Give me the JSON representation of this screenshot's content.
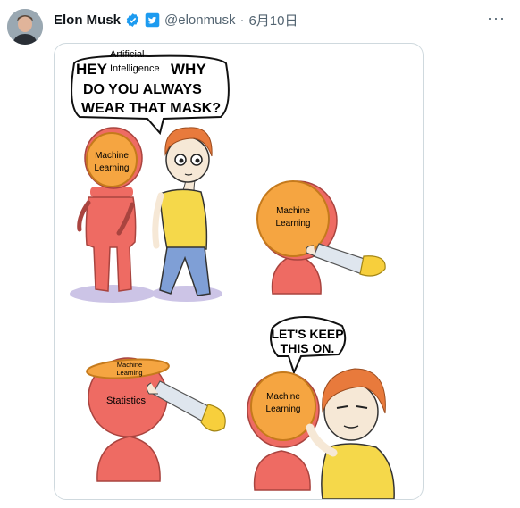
{
  "tweet": {
    "author_name": "Elon Musk",
    "verified_icon": "verified-badge-icon",
    "twitter_icon": "twitter-bird-icon",
    "handle": "@elonmusk",
    "separator": "·",
    "date": "6月10日",
    "more_icon": "more-dots-icon"
  },
  "comic": {
    "panel1": {
      "bubble_hey": "HEY",
      "bubble_ai_line1": "Artificial",
      "bubble_ai_line2": "Intelligence",
      "bubble_why": "WHY",
      "bubble_line2": "DO YOU ALWAYS",
      "bubble_line3": "WEAR THAT MASK?",
      "mask_line1": "Machine",
      "mask_line2": "Learning"
    },
    "panel2": {
      "mask_line1": "Machine",
      "mask_line2": "Learning"
    },
    "panel3": {
      "mask_line1": "Machine",
      "mask_line2": "Learning",
      "head_label": "Statistics"
    },
    "panel4": {
      "bubble_line1": "LET'S KEEP",
      "bubble_line2": "THIS ON.",
      "mask_line1": "Machine",
      "mask_line2": "Learning"
    }
  },
  "colors": {
    "robot_body": "#ee6b63",
    "mask_orange": "#f5a541",
    "shirt_yellow": "#f5d84a",
    "hair_orange": "#e87a3c",
    "jeans_blue": "#7f9fd6",
    "glove_yellow": "#f7cf3c",
    "shadow_purple": "#ccc4e6"
  }
}
